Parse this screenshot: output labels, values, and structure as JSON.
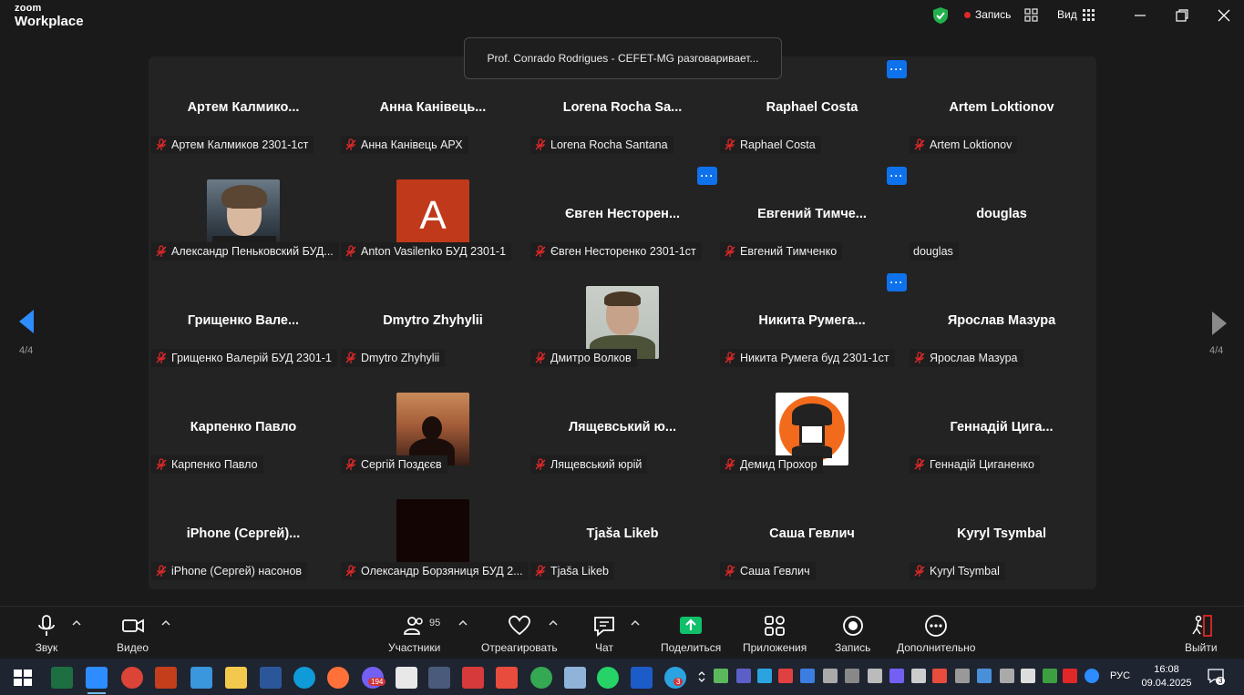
{
  "app": {
    "brand_line1": "zoom",
    "brand_line2": "Workplace"
  },
  "titlebar": {
    "record_label": "Запись",
    "view_label": "Вид"
  },
  "notification": "Prof. Conrado Rodrigues - CEFET-MG разговаривает...",
  "pages": {
    "left": "4/4",
    "right": "4/4"
  },
  "tiles": [
    {
      "name": "Артем  Калмико...",
      "label": "Артем Калмиков 2301-1ст"
    },
    {
      "name": "Анна  Канівець...",
      "label": "Анна Канівець АРХ"
    },
    {
      "name": "Lorena Rocha Sa...",
      "label": "Lorena Rocha Santana",
      "more": true
    },
    {
      "name": "Raphael Costa",
      "label": "Raphael Costa",
      "more": true
    },
    {
      "name": "Artem Loktionov",
      "label": "Artem Loktionov"
    },
    {
      "name": "",
      "label": "Александр Пеньковский БУД...",
      "avatar": "photo-boy"
    },
    {
      "name": "",
      "label": "Anton Vasilenko БУД 2301-1",
      "avatar": "letter",
      "letter": "A",
      "color": "#c0391b"
    },
    {
      "name": "Євген  Несторен...",
      "label": "Євген Несторенко 2301-1ст",
      "more": true
    },
    {
      "name": "Евгений  Тимче...",
      "label": "Евгений Тимченко",
      "more": true
    },
    {
      "name": "douglas",
      "label": "douglas",
      "micoff": false
    },
    {
      "name": "Грищенко  Вале...",
      "label": "Грищенко Валерій БУД 2301-1"
    },
    {
      "name": "Dmytro Zhyhylii",
      "label": "Dmytro Zhyhylii"
    },
    {
      "name": "",
      "label": "Дмитро Волков",
      "avatar": "photo-man"
    },
    {
      "name": "Никита  Румега...",
      "label": "Никита Румега буд 2301-1ст",
      "more": true
    },
    {
      "name": "Ярослав Мазура",
      "label": "Ярослав Мазура"
    },
    {
      "name": "Карпенко Павло",
      "label": "Карпенко Павло"
    },
    {
      "name": "",
      "label": "Сергій Поздєєв",
      "avatar": "photo-sunset"
    },
    {
      "name": "Лящевський  ю...",
      "label": "Лящевський юрій"
    },
    {
      "name": "",
      "label": "Демид Прохор",
      "avatar": "logo-helmet"
    },
    {
      "name": "Геннадій  Цига...",
      "label": "Геннадій  Циганенко"
    },
    {
      "name": "iPhone  (Сергей)...",
      "label": "iPhone (Сергей) насонов"
    },
    {
      "name": "",
      "label": "Олександр Борзяниця БУД 2...",
      "avatar": "dark"
    },
    {
      "name": "Tjaša Likeb",
      "label": "Tjaša Likeb"
    },
    {
      "name": "Саша Гевлич",
      "label": "Саша Гевлич"
    },
    {
      "name": "Kyryl Tsymbal",
      "label": "Kyryl Tsymbal"
    }
  ],
  "toolbar": {
    "audio": "Звук",
    "video": "Видео",
    "participants": "Участники",
    "participants_count": "95",
    "react": "Отреагировать",
    "chat": "Чат",
    "share": "Поделиться",
    "apps": "Приложения",
    "record": "Запись",
    "more": "Дополнительно",
    "leave": "Выйти"
  },
  "taskbar": {
    "time": "16:08",
    "date": "09.04.2025",
    "lang": "РУС",
    "viber_badge": "194",
    "app_badge": "3",
    "notif_count": "3"
  },
  "colors": {
    "accent": "#0e72ed",
    "mic_off": "#e02828",
    "share": "#10c06a"
  }
}
